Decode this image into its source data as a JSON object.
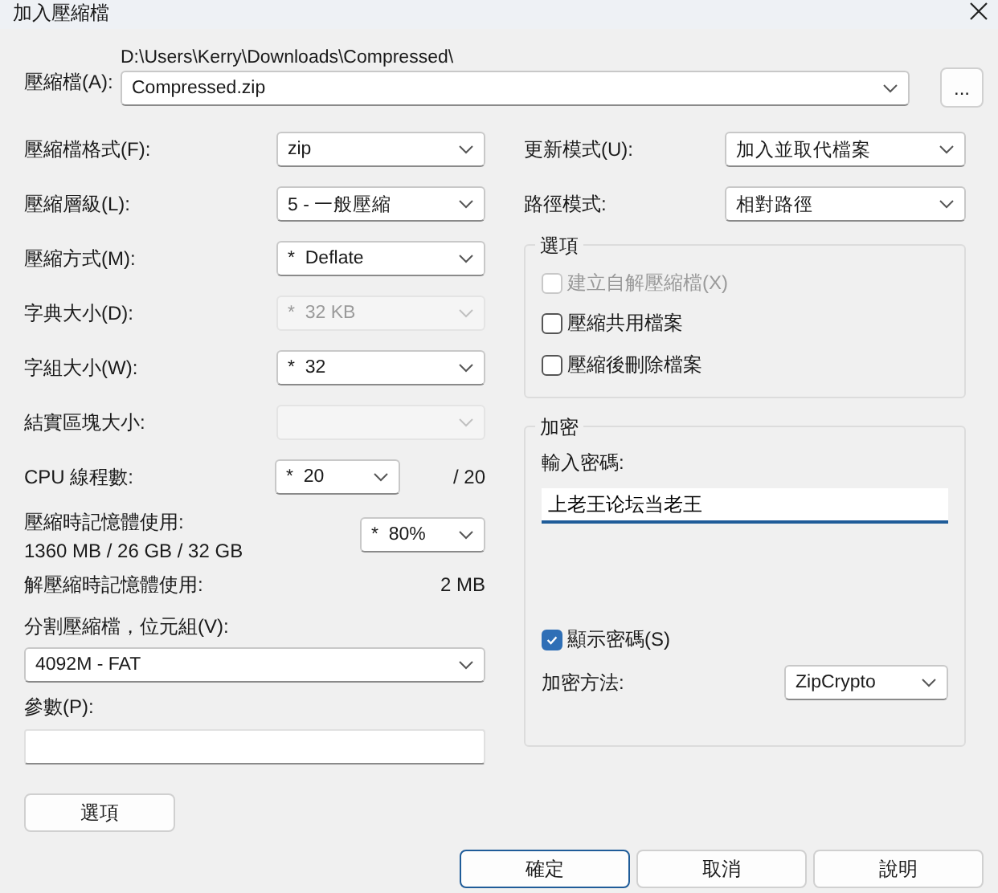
{
  "window": {
    "title": "加入壓縮檔"
  },
  "archive": {
    "label": "壓縮檔(A):",
    "folder": "D:\\Users\\Kerry\\Downloads\\Compressed\\",
    "value": "Compressed.zip",
    "browse": "..."
  },
  "left_rows": [
    {
      "kind": "select",
      "label": "壓縮檔格式(F):",
      "value": "zip",
      "disabled": false
    },
    {
      "kind": "select",
      "label": "壓縮層級(L):",
      "value": "5 - 一般壓縮",
      "disabled": false
    },
    {
      "kind": "select",
      "label": "壓縮方式(M):",
      "value": "*  Deflate",
      "disabled": false
    },
    {
      "kind": "select",
      "label": "字典大小(D):",
      "value": "*  32 KB",
      "disabled": true
    },
    {
      "kind": "select",
      "label": "字組大小(W):",
      "value": "*  32",
      "disabled": false
    },
    {
      "kind": "select",
      "label": "結實區塊大小:",
      "value": "",
      "disabled": true
    },
    {
      "kind": "threads",
      "label": "CPU 線程數:",
      "value": "*  20",
      "total": "/ 20"
    },
    {
      "kind": "memory",
      "label": "壓縮時記憶體使用:",
      "detail": "1360 MB / 26 GB / 32 GB",
      "value": "*  80%"
    },
    {
      "kind": "info",
      "label": "解壓縮時記憶體使用:",
      "value": "2 MB"
    }
  ],
  "split": {
    "label": "分割壓縮檔，位元組(V):",
    "value": "4092M - FAT"
  },
  "params": {
    "label": "參數(P):"
  },
  "options_button": "選項",
  "right_rows": [
    {
      "label": "更新模式(U):",
      "value": "加入並取代檔案"
    },
    {
      "label": "路徑模式:",
      "value": "相對路徑"
    }
  ],
  "options_group": {
    "title": "選項",
    "checkboxes": [
      {
        "label": "建立自解壓縮檔(X)",
        "checked": false,
        "disabled": true
      },
      {
        "label": "壓縮共用檔案",
        "checked": false,
        "disabled": false
      },
      {
        "label": "壓縮後刪除檔案",
        "checked": false,
        "disabled": false
      }
    ]
  },
  "encryption": {
    "title": "加密",
    "password_label": "輸入密碼:",
    "password": "上老王论坛当老王",
    "show_password": {
      "label": "顯示密碼(S)",
      "checked": true
    },
    "method_label": "加密方法:",
    "method": "ZipCrypto"
  },
  "buttons": [
    {
      "label": "確定",
      "default": true
    },
    {
      "label": "取消",
      "default": false
    },
    {
      "label": "說明",
      "default": false
    }
  ]
}
